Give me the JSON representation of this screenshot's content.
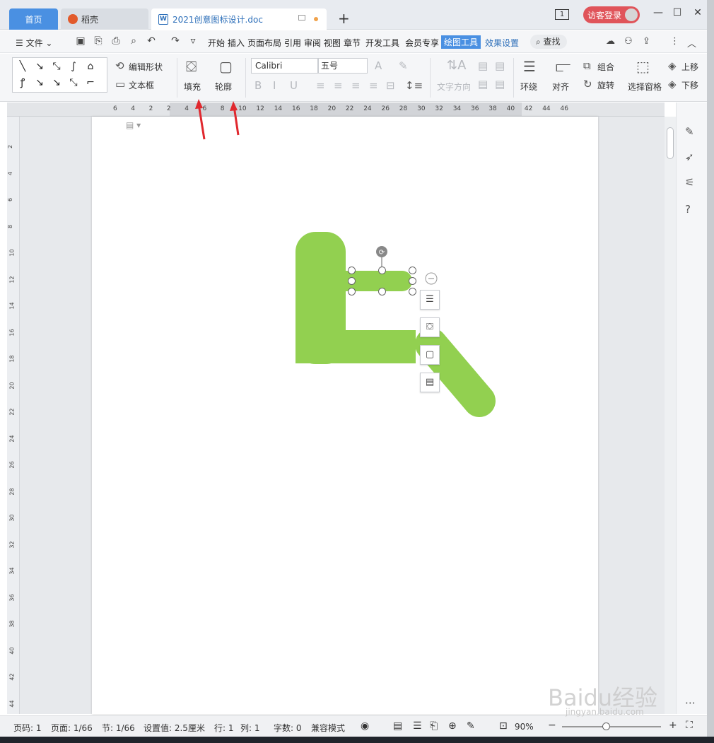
{
  "tabs": {
    "home": "首页",
    "daoke": "稻壳",
    "doc": "2021创意图标设计.doc",
    "new_tab": "+"
  },
  "titlebar": {
    "badge": "1",
    "guest_login": "访客登录"
  },
  "menubar": {
    "file": "文件",
    "items": [
      "开始",
      "插入",
      "页面布局",
      "引用",
      "审阅",
      "视图",
      "章节",
      "开发工具",
      "会员专享"
    ],
    "draw_tools": "绘图工具",
    "effects": "效果设置",
    "search": "查找"
  },
  "ribbon": {
    "edit_shape": "编辑形状",
    "text_box": "文本框",
    "fill": "填充",
    "outline": "轮廓",
    "font_name": "Calibri",
    "font_size": "五号",
    "text_direction": "文字方向",
    "wrap": "环绕",
    "align": "对齐",
    "group": "组合",
    "rotate": "旋转",
    "selection_pane": "选择窗格",
    "bring_up": "上移",
    "send_down": "下移"
  },
  "ruler_marks": [
    "6",
    "4",
    "2",
    "2",
    "4",
    "6",
    "8",
    "10",
    "12",
    "14",
    "16",
    "18",
    "20",
    "22",
    "24",
    "26",
    "28",
    "30",
    "32",
    "34",
    "36",
    "38",
    "40",
    "42",
    "44",
    "46"
  ],
  "vruler_marks": [
    "2",
    "4",
    "6",
    "8",
    "10",
    "12",
    "14",
    "16",
    "18",
    "20",
    "22",
    "24",
    "26",
    "28",
    "30",
    "32",
    "34",
    "36",
    "38",
    "40",
    "42",
    "44"
  ],
  "shape": {
    "fill_color": "#92d050"
  },
  "statusbar": {
    "page_code": "页码: 1",
    "pages": "页面: 1/66",
    "section": "节: 1/66",
    "setting": "设置值: 2.5厘米",
    "row": "行: 1",
    "col": "列: 1",
    "words": "字数: 0",
    "compat": "兼容模式",
    "zoom": "90%"
  },
  "watermark": {
    "brand": "Baidu经验",
    "url": "jingyan.baidu.com"
  }
}
